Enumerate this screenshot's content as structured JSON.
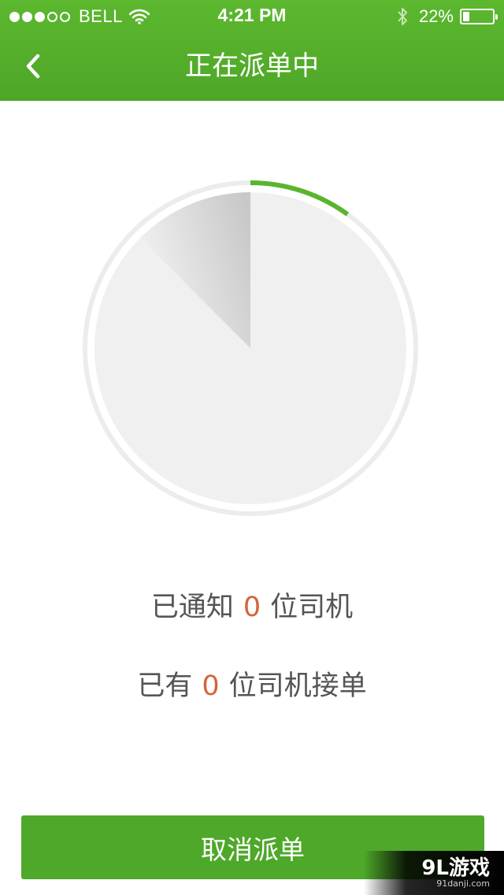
{
  "status_bar": {
    "signal_filled": 3,
    "signal_total": 5,
    "carrier": "BELL",
    "time": "4:21 PM",
    "battery_percent_label": "22%",
    "battery_level": 0.22
  },
  "nav": {
    "title": "正在派单中"
  },
  "radar": {
    "progress_fraction": 0.1,
    "progress_color": "#5ab52e",
    "track_color": "#ececec",
    "disc_color": "#f0f0f0"
  },
  "notify": {
    "prefix": "已通知",
    "count": "0",
    "suffix": "位司机"
  },
  "accepted": {
    "prefix": "已有",
    "count": "0",
    "suffix": "位司机接单"
  },
  "cancel_button": {
    "label": "取消派单"
  },
  "watermark": {
    "main": "9L游戏",
    "sub": "91danji.com"
  },
  "colors": {
    "header_green": "#55b02c",
    "button_green": "#4ea82a",
    "count_orange": "#d4643a"
  }
}
